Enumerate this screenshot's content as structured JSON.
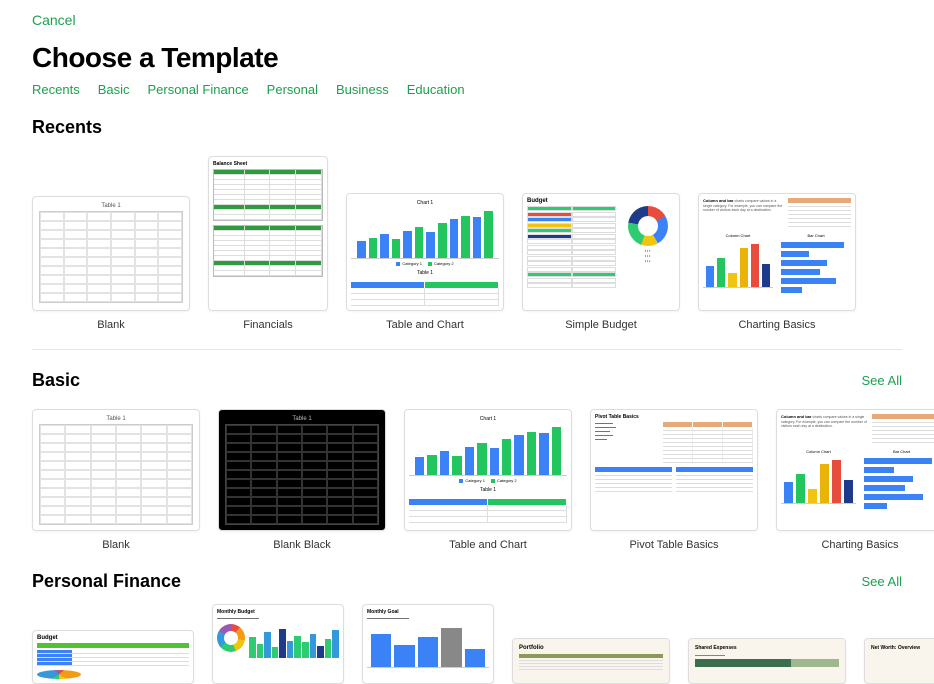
{
  "header": {
    "cancel": "Cancel",
    "title": "Choose a Template"
  },
  "tabs": [
    "Recents",
    "Basic",
    "Personal Finance",
    "Personal",
    "Business",
    "Education"
  ],
  "seeAll": "See All",
  "sections": {
    "recents": {
      "title": "Recents",
      "items": [
        "Blank",
        "Financials",
        "Table and Chart",
        "Simple Budget",
        "Charting Basics"
      ]
    },
    "basic": {
      "title": "Basic",
      "items": [
        "Blank",
        "Blank Black",
        "Table and Chart",
        "Pivot Table Basics",
        "Charting Basics"
      ]
    },
    "personalFinance": {
      "title": "Personal Finance",
      "items": [
        "Budget",
        "Monthly Budget",
        "Monthly Goal",
        "Portfolio",
        "Shared Expenses",
        "Net Worth: Overview"
      ]
    }
  },
  "thumbLabels": {
    "table1": "Table 1",
    "balanceSheet": "Balance Sheet",
    "chart1": "Chart 1",
    "category1": "Category 1",
    "category2": "Category 2",
    "budget": "Budget",
    "columnChart": "Column Chart",
    "barChart": "Bar Chart",
    "pivotTitle": "Pivot Table Basics",
    "chartingTitle": "Column and bar",
    "chartingText": "charts compare values in a single category. For example, you can compare the number of visitors each day at a destination.",
    "monthlyBudget": "Monthly Budget",
    "monthlyGoal": "Monthly Goal",
    "portfolio": "Portfolio",
    "sharedExpenses": "Shared Expenses",
    "netWorth": "Net Worth: Overview"
  },
  "chart_data": [
    {
      "id": "recents-table-and-chart",
      "type": "bar",
      "title": "Chart 1",
      "series": [
        {
          "name": "Category 1",
          "values": [
            20,
            28,
            32,
            30,
            45,
            48
          ],
          "color": "#3b82f6"
        },
        {
          "name": "Category 2",
          "values": [
            25,
            22,
            38,
            42,
            50,
            55
          ],
          "color": "#22c55e"
        }
      ]
    },
    {
      "id": "recents-simple-budget-donut",
      "type": "pie",
      "slices": [
        {
          "color": "#e74c3c",
          "value": 60
        },
        {
          "color": "#3b82f6",
          "value": 90
        },
        {
          "color": "#f1c40f",
          "value": 50
        },
        {
          "color": "#2ecc71",
          "value": 80
        },
        {
          "color": "#1e3a8a",
          "value": 80
        }
      ]
    },
    {
      "id": "recents-charting-basics-column",
      "type": "bar",
      "title": "Column Chart",
      "values": [
        22,
        30,
        15,
        40,
        45,
        25
      ],
      "colors": [
        "#3b82f6",
        "#22c55e",
        "#f1c40f",
        "#eab308",
        "#e74c3c",
        "#1e3a8a"
      ]
    },
    {
      "id": "recents-charting-basics-bar",
      "type": "bar",
      "orientation": "horizontal",
      "title": "Bar Chart",
      "values": [
        90,
        40,
        65,
        55,
        78,
        30
      ],
      "color": "#3b82f6"
    },
    {
      "id": "pf-monthly-goal",
      "type": "bar",
      "values": [
        38,
        25,
        34,
        45,
        20
      ],
      "colors": [
        "#3b82f6",
        "#3b82f6",
        "#3b82f6",
        "#888888",
        "#3b82f6"
      ]
    }
  ]
}
